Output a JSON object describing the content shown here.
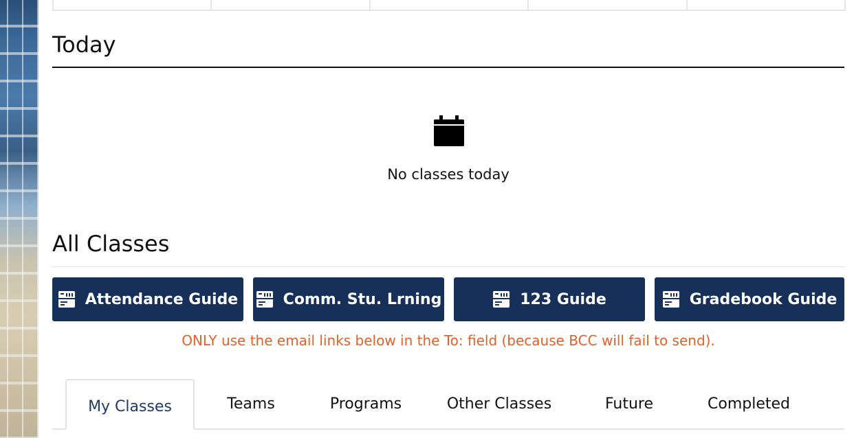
{
  "today": {
    "title": "Today",
    "empty_icon": "calendar-icon",
    "empty_text": "No classes today"
  },
  "all_classes": {
    "title": "All Classes",
    "guide_buttons": [
      {
        "label": "Attendance Guide",
        "icon": "document-icon"
      },
      {
        "label": "Comm. Stu. Lrning",
        "icon": "document-icon"
      },
      {
        "label": "123 Guide",
        "icon": "document-icon"
      },
      {
        "label": "Gradebook Guide",
        "icon": "document-icon"
      }
    ],
    "notice": "ONLY use the email links below in the To: field (because BCC will fail to send).",
    "tabs": [
      {
        "label": "My Classes",
        "active": true
      },
      {
        "label": "Teams",
        "active": false
      },
      {
        "label": "Programs",
        "active": false
      },
      {
        "label": "Other Classes",
        "active": false
      },
      {
        "label": "Future",
        "active": false
      },
      {
        "label": "Completed",
        "active": false
      }
    ]
  },
  "colors": {
    "button_bg": "#16305a",
    "notice": "#e0622a",
    "active_tab_text": "#1f3b66"
  }
}
